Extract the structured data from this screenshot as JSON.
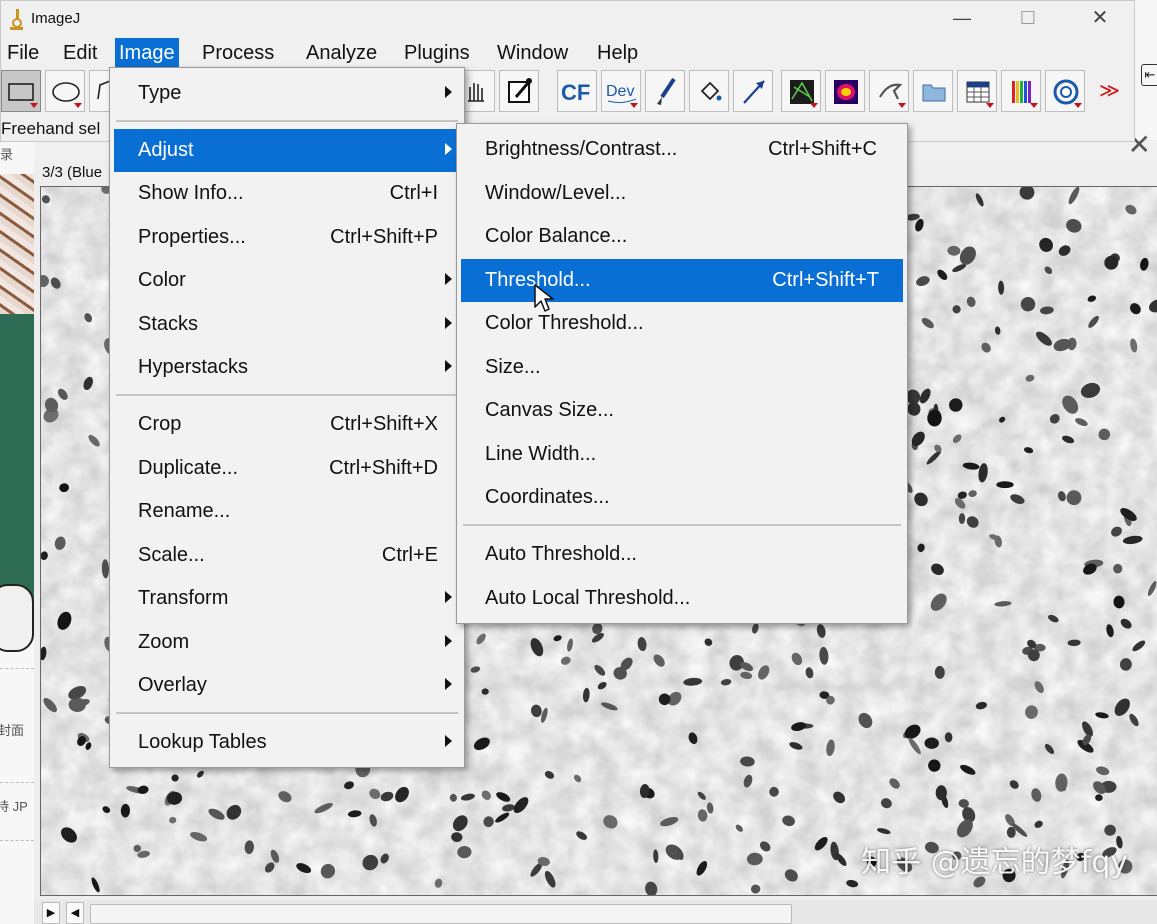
{
  "app": {
    "title": "ImageJ",
    "status_text": "Freehand sel"
  },
  "window_controls": {
    "minimize": "—",
    "maximize": "☐",
    "close": "✕"
  },
  "menubar": [
    "File",
    "Edit",
    "Image",
    "Process",
    "Analyze",
    "Plugins",
    "Window",
    "Help"
  ],
  "toolbar": {
    "cf_label": "CF",
    "dev_label": "Dev",
    "more_label": "≫"
  },
  "image_window": {
    "info_text": "3/3 (Blue",
    "close_glyph": "✕"
  },
  "image_menu": {
    "items": [
      {
        "label": "Type",
        "shortcut": "",
        "submenu": true
      },
      {
        "label": "Adjust",
        "shortcut": "",
        "submenu": true
      },
      {
        "label": "Show Info...",
        "shortcut": "Ctrl+I"
      },
      {
        "label": "Properties...",
        "shortcut": "Ctrl+Shift+P"
      },
      {
        "label": "Color",
        "shortcut": "",
        "submenu": true
      },
      {
        "label": "Stacks",
        "shortcut": "",
        "submenu": true
      },
      {
        "label": "Hyperstacks",
        "shortcut": "",
        "submenu": true
      },
      {
        "label": "Crop",
        "shortcut": "Ctrl+Shift+X"
      },
      {
        "label": "Duplicate...",
        "shortcut": "Ctrl+Shift+D"
      },
      {
        "label": "Rename...",
        "shortcut": ""
      },
      {
        "label": "Scale...",
        "shortcut": "Ctrl+E"
      },
      {
        "label": "Transform",
        "shortcut": "",
        "submenu": true
      },
      {
        "label": "Zoom",
        "shortcut": "",
        "submenu": true
      },
      {
        "label": "Overlay",
        "shortcut": "",
        "submenu": true
      },
      {
        "label": "Lookup Tables",
        "shortcut": "",
        "submenu": true
      }
    ]
  },
  "adjust_menu": {
    "items": [
      {
        "label": "Brightness/Contrast...",
        "shortcut": "Ctrl+Shift+C"
      },
      {
        "label": "Window/Level...",
        "shortcut": ""
      },
      {
        "label": "Color Balance...",
        "shortcut": ""
      },
      {
        "label": "Threshold...",
        "shortcut": "Ctrl+Shift+T"
      },
      {
        "label": "Color Threshold...",
        "shortcut": ""
      },
      {
        "label": "Size...",
        "shortcut": ""
      },
      {
        "label": "Canvas Size...",
        "shortcut": ""
      },
      {
        "label": "Line Width...",
        "shortcut": ""
      },
      {
        "label": "Coordinates...",
        "shortcut": ""
      },
      {
        "label": "Auto Threshold...",
        "shortcut": ""
      },
      {
        "label": "Auto Local Threshold...",
        "shortcut": ""
      }
    ]
  },
  "background_window": {
    "sidebar_texts": [
      "录",
      "封面",
      "持 JP"
    ]
  },
  "watermark": "知乎 @遗忘的梦fqy",
  "colors": {
    "highlight": "#0a6fd4",
    "menu_bg": "#f2f2f2"
  }
}
